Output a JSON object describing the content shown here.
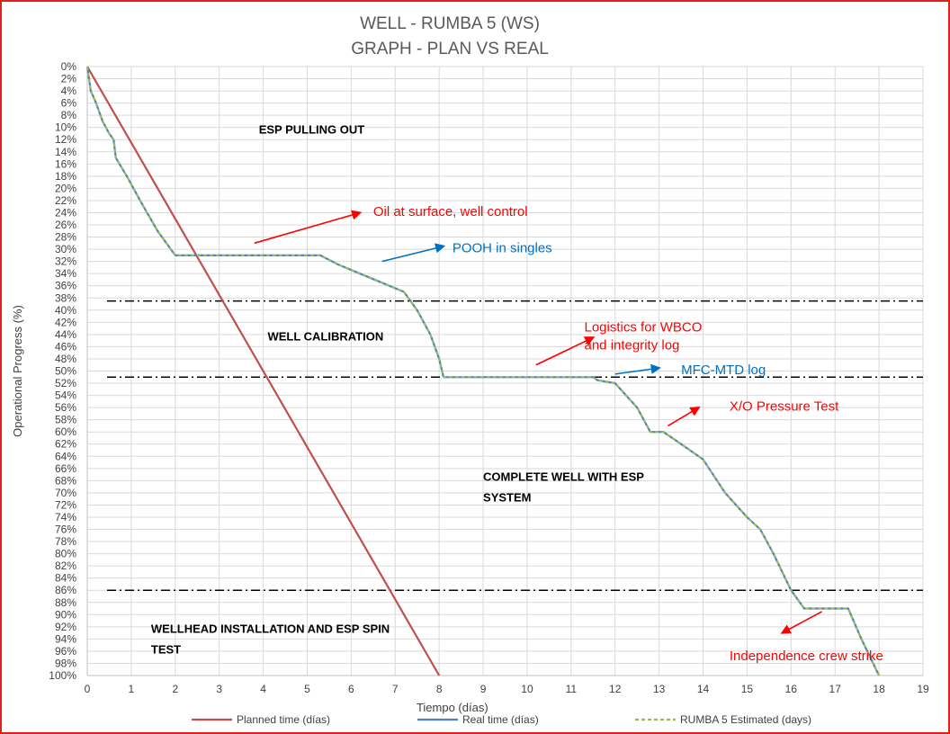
{
  "chart_data": {
    "type": "line",
    "title": [
      "WELL -  RUMBA 5 (WS)",
      "GRAPH  - PLAN VS REAL"
    ],
    "xlabel": "Tiempo (días)",
    "ylabel": "Operational Progress (%)",
    "xlim": [
      0,
      19
    ],
    "ylim": [
      0,
      100
    ],
    "y_inverted": true,
    "x_ticks": [
      0,
      1,
      2,
      3,
      4,
      5,
      6,
      7,
      8,
      9,
      10,
      11,
      12,
      13,
      14,
      15,
      16,
      17,
      18,
      19
    ],
    "y_ticks": [
      0,
      2,
      4,
      6,
      8,
      10,
      12,
      14,
      16,
      18,
      20,
      22,
      24,
      26,
      28,
      30,
      32,
      34,
      36,
      38,
      40,
      42,
      44,
      46,
      48,
      50,
      52,
      54,
      56,
      58,
      60,
      62,
      64,
      66,
      68,
      70,
      72,
      74,
      76,
      78,
      80,
      82,
      84,
      86,
      88,
      90,
      92,
      94,
      96,
      98,
      100
    ],
    "grid": true,
    "legend_position": "bottom",
    "series": [
      {
        "name": "Planned time (días)",
        "color": "#c0504d",
        "points": [
          [
            0,
            0
          ],
          [
            8,
            100
          ]
        ]
      },
      {
        "name": "Real time (días)",
        "color": "#4f81bd",
        "points": [
          [
            0,
            0
          ],
          [
            0.08,
            4
          ],
          [
            0.2,
            6
          ],
          [
            0.35,
            9
          ],
          [
            0.5,
            11
          ],
          [
            0.6,
            12
          ],
          [
            0.65,
            15
          ],
          [
            0.9,
            18
          ],
          [
            1.2,
            22
          ],
          [
            1.6,
            27
          ],
          [
            2,
            31
          ],
          [
            2.3,
            31
          ],
          [
            3,
            31
          ],
          [
            4,
            31
          ],
          [
            5.3,
            31
          ],
          [
            5.7,
            32.5
          ],
          [
            6.2,
            34
          ],
          [
            6.7,
            35.5
          ],
          [
            7.2,
            37
          ],
          [
            7.5,
            40
          ],
          [
            7.8,
            44
          ],
          [
            8,
            48
          ],
          [
            8.1,
            51
          ],
          [
            9,
            51
          ],
          [
            10,
            51
          ],
          [
            11.5,
            51
          ],
          [
            11.6,
            51.5
          ],
          [
            12,
            52
          ],
          [
            12.5,
            56
          ],
          [
            12.8,
            60
          ],
          [
            13.1,
            60
          ],
          [
            13.5,
            62
          ],
          [
            14,
            64.5
          ],
          [
            14.5,
            70
          ],
          [
            15,
            74
          ],
          [
            15.3,
            76
          ],
          [
            15.6,
            80
          ],
          [
            16,
            86
          ],
          [
            16.3,
            89
          ],
          [
            17.3,
            89
          ],
          [
            17.6,
            94
          ],
          [
            18,
            100
          ]
        ]
      },
      {
        "name": "RUMBA 5 Estimated (days)",
        "color": "#9bbb59",
        "dashed": true,
        "points": [
          [
            0,
            0
          ],
          [
            0.08,
            4
          ],
          [
            0.2,
            6
          ],
          [
            0.35,
            9
          ],
          [
            0.5,
            11
          ],
          [
            0.6,
            12
          ],
          [
            0.65,
            15
          ],
          [
            0.9,
            18
          ],
          [
            1.2,
            22
          ],
          [
            1.6,
            27
          ],
          [
            2,
            31
          ],
          [
            2.3,
            31
          ],
          [
            3,
            31
          ],
          [
            4,
            31
          ],
          [
            5.3,
            31
          ],
          [
            5.7,
            32.5
          ],
          [
            6.2,
            34
          ],
          [
            6.7,
            35.5
          ],
          [
            7.2,
            37
          ],
          [
            7.5,
            40
          ],
          [
            7.8,
            44
          ],
          [
            8,
            48
          ],
          [
            8.1,
            51
          ],
          [
            9,
            51
          ],
          [
            10,
            51
          ],
          [
            11.5,
            51
          ],
          [
            11.6,
            51.5
          ],
          [
            12,
            52
          ],
          [
            12.5,
            56
          ],
          [
            12.8,
            60
          ],
          [
            13.1,
            60
          ],
          [
            13.5,
            62
          ],
          [
            14,
            64.5
          ],
          [
            14.5,
            70
          ],
          [
            15,
            74
          ],
          [
            15.3,
            76
          ],
          [
            15.6,
            80
          ],
          [
            16,
            86
          ],
          [
            16.3,
            89
          ],
          [
            17.3,
            89
          ],
          [
            17.6,
            94
          ],
          [
            18,
            100
          ]
        ]
      }
    ],
    "phase_separators": [
      38.5,
      51,
      86
    ],
    "phase_labels": [
      {
        "lines": [
          "ESP PULLING OUT"
        ],
        "x": 3.9,
        "y": 11
      },
      {
        "lines": [
          "WELL CALIBRATION"
        ],
        "x": 4.1,
        "y": 45
      },
      {
        "lines": [
          "COMPLETE WELL WITH ESP",
          "SYSTEM"
        ],
        "x": 9.0,
        "y": 68
      },
      {
        "lines": [
          "WELLHEAD INSTALLATION AND ESP SPIN",
          "TEST"
        ],
        "x": 1.45,
        "y": 93
      }
    ],
    "annotations": [
      {
        "lines": [
          "Oil at surface, well control"
        ],
        "color": "#ff0000",
        "tx": 6.5,
        "ty": 24.5,
        "ax1": 3.8,
        "ay1": 29,
        "ax2": 6.2,
        "ay2": 24
      },
      {
        "lines": [
          "POOH in singles"
        ],
        "color": "#0070c0",
        "tx": 8.3,
        "ty": 30.5,
        "ax1": 6.7,
        "ay1": 32,
        "ax2": 8.1,
        "ay2": 29.5
      },
      {
        "lines": [
          "Logistics for WBCO",
          "and integrity log"
        ],
        "color": "#ff0000",
        "tx": 11.3,
        "ty": 43.5,
        "ax1": 10.2,
        "ay1": 49,
        "ax2": 11.5,
        "ay2": 44.5
      },
      {
        "lines": [
          "MFC-MTD log"
        ],
        "color": "#0070c0",
        "tx": 13.5,
        "ty": 50.5,
        "ax1": 12,
        "ay1": 50.5,
        "ax2": 13,
        "ay2": 49.5
      },
      {
        "lines": [
          "X/O Pressure Test"
        ],
        "color": "#ff0000",
        "tx": 14.6,
        "ty": 56.5,
        "ax1": 13.2,
        "ay1": 59,
        "ax2": 13.9,
        "ay2": 56
      },
      {
        "lines": [
          "Independence crew strike"
        ],
        "color": "#ff0000",
        "tx": 14.6,
        "ty": 97.5,
        "ax1": 16.7,
        "ay1": 89.5,
        "ax2": 15.8,
        "ay2": 93
      }
    ]
  }
}
